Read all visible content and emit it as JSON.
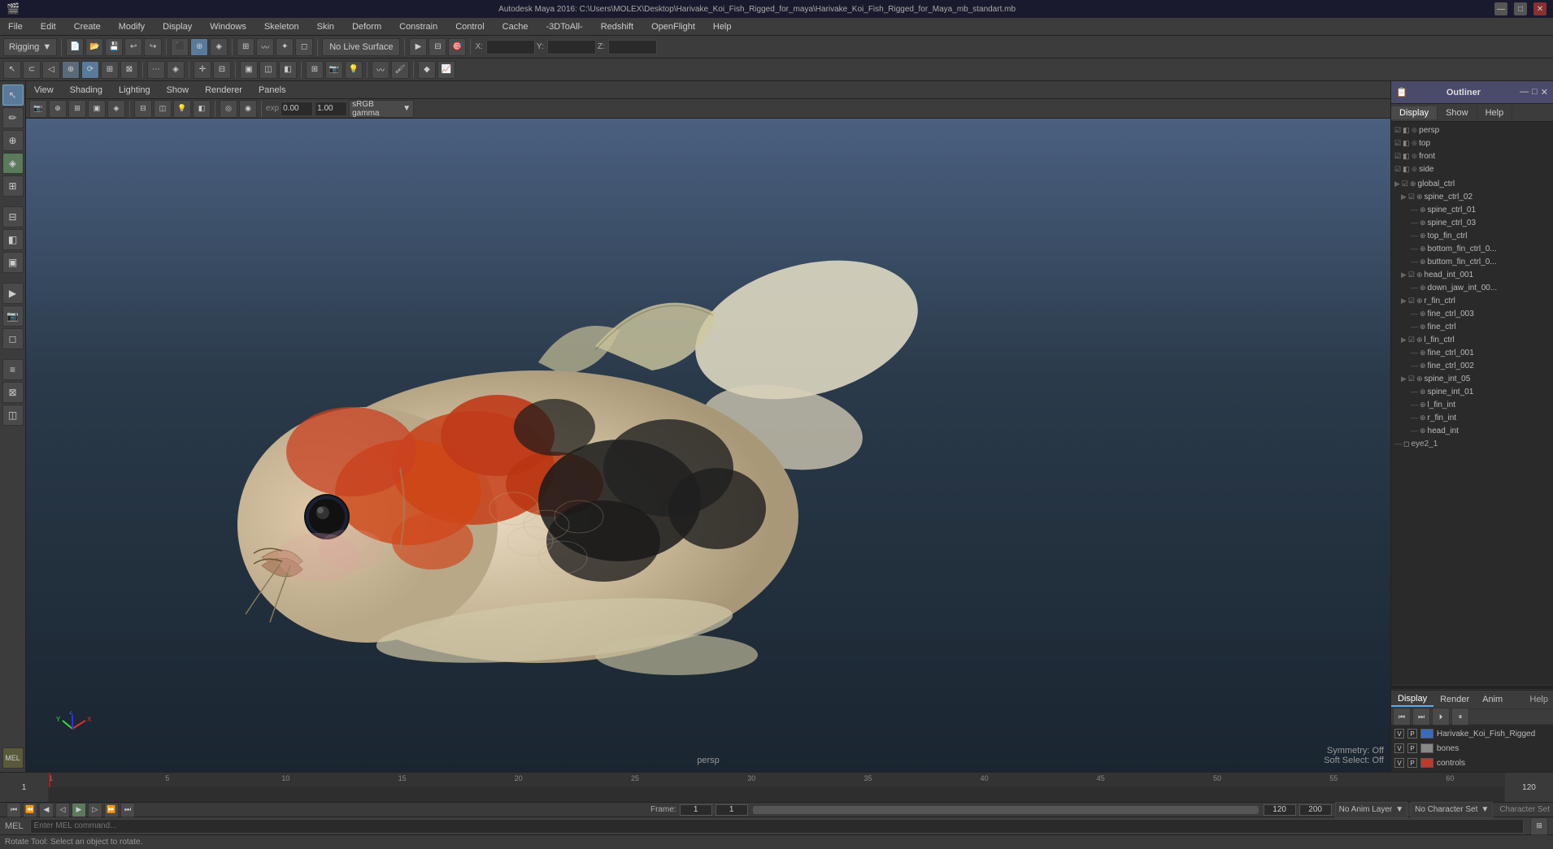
{
  "window": {
    "title": "Autodesk Maya 2016: C:\\Users\\MOLEX\\Desktop\\Harivake_Koi_Fish_Rigged_for_maya\\Harivake_Koi_Fish_Rigged_for_Maya_mb_standart.mb",
    "min_btn": "—",
    "max_btn": "□",
    "close_btn": "✕"
  },
  "menubar": {
    "items": [
      "File",
      "Edit",
      "Create",
      "Modify",
      "Display",
      "Windows",
      "Skeleton",
      "Skin",
      "Deform",
      "Constrain",
      "Control",
      "Cache",
      "-3DToAll-",
      "Redshift",
      "OpenFlight",
      "Help"
    ]
  },
  "toolbar1": {
    "mode_dropdown": "Rigging",
    "no_live_label": "No Live Surface",
    "x_label": "X:",
    "y_label": "Y:",
    "z_label": "Z:"
  },
  "viewport_menu": {
    "items": [
      "View",
      "Shading",
      "Lighting",
      "Show",
      "Renderer",
      "Panels"
    ]
  },
  "viewport": {
    "label": "persp",
    "symmetry_label": "Symmetry:",
    "symmetry_value": "Off",
    "soft_select_label": "Soft Select:",
    "soft_select_value": "Off"
  },
  "color_fields": {
    "val1": "0.00",
    "val2": "1.00",
    "gamma_label": "sRGB gamma"
  },
  "outliner": {
    "title": "Outliner",
    "tabs": [
      "Display",
      "Show",
      "Help"
    ],
    "tree_items": [
      {
        "label": "persp",
        "indent": 0,
        "icon": "cam",
        "has_check": true
      },
      {
        "label": "top",
        "indent": 0,
        "icon": "cam",
        "has_check": true
      },
      {
        "label": "front",
        "indent": 0,
        "icon": "cam",
        "has_check": true
      },
      {
        "label": "side",
        "indent": 0,
        "icon": "cam",
        "has_check": true
      },
      {
        "label": "global_ctrl",
        "indent": 0,
        "icon": "ctrl",
        "has_check": false
      },
      {
        "label": "spine_ctrl_02",
        "indent": 1,
        "icon": "ctrl",
        "has_check": false
      },
      {
        "label": "spine_ctrl_01",
        "indent": 2,
        "icon": "box",
        "has_check": false
      },
      {
        "label": "spine_ctrl_03",
        "indent": 2,
        "icon": "box",
        "has_check": false
      },
      {
        "label": "top_fin_ctrl",
        "indent": 2,
        "icon": "box",
        "has_check": false
      },
      {
        "label": "bottom_fin_ctrl_0...",
        "indent": 2,
        "icon": "box",
        "has_check": false
      },
      {
        "label": "buttom_fin_ctrl_0...",
        "indent": 2,
        "icon": "box",
        "has_check": false
      },
      {
        "label": "head_int_001",
        "indent": 1,
        "icon": "box",
        "has_check": false
      },
      {
        "label": "down_jaw_int_00...",
        "indent": 2,
        "icon": "box",
        "has_check": false
      },
      {
        "label": "r_fin_ctrl",
        "indent": 1,
        "icon": "ctrl",
        "has_check": false
      },
      {
        "label": "fine_ctrl_003",
        "indent": 2,
        "icon": "box",
        "has_check": false
      },
      {
        "label": "fine_ctrl",
        "indent": 2,
        "icon": "box",
        "has_check": false
      },
      {
        "label": "l_fin_ctrl",
        "indent": 1,
        "icon": "ctrl",
        "has_check": false
      },
      {
        "label": "fine_ctrl_001",
        "indent": 2,
        "icon": "box",
        "has_check": false
      },
      {
        "label": "fine_ctrl_002",
        "indent": 2,
        "icon": "box",
        "has_check": false
      },
      {
        "label": "spine_int_05",
        "indent": 1,
        "icon": "box",
        "has_check": false
      },
      {
        "label": "spine_int_01",
        "indent": 2,
        "icon": "box",
        "has_check": false
      },
      {
        "label": "l_fin_int",
        "indent": 2,
        "icon": "box",
        "has_check": false
      },
      {
        "label": "r_fin_int",
        "indent": 2,
        "icon": "box",
        "has_check": false
      },
      {
        "label": "head_int",
        "indent": 2,
        "icon": "box",
        "has_check": false
      },
      {
        "label": "eye2_1",
        "indent": 0,
        "icon": "mesh",
        "has_check": false
      }
    ]
  },
  "layers": {
    "tabs": [
      "Display",
      "Render",
      "Anim"
    ],
    "toolbar_btns": [
      "new",
      "options"
    ],
    "items": [
      {
        "v": "V",
        "p": "P",
        "color": "#3a6abf",
        "name": "Harivake_Koi_Fish_Rigged"
      },
      {
        "v": "V",
        "p": "P",
        "color": "#888",
        "name": "bones"
      },
      {
        "v": "V",
        "p": "P",
        "color": "#c0392b",
        "name": "controls"
      }
    ]
  },
  "timeline": {
    "start": "1",
    "end": "120",
    "current_frame": "1",
    "range_start": "1",
    "range_end": "120",
    "anim_end": "200",
    "no_anim_label": "No Anim Layer",
    "no_char_label": "No Character Set",
    "char_set_label": "Character Set"
  },
  "bottom": {
    "mel_label": "MEL",
    "status_text": "Rotate Tool: Select an object to rotate."
  },
  "side_tools": [
    "↖",
    "↕",
    "↔",
    "⟳",
    "⊕",
    "◈",
    "▣",
    "◫",
    "⊞",
    "≡",
    "⊟",
    "◧",
    "⊠"
  ],
  "icons": {
    "axis_x": "X",
    "axis_y": "Y",
    "axis_z": "Z"
  }
}
